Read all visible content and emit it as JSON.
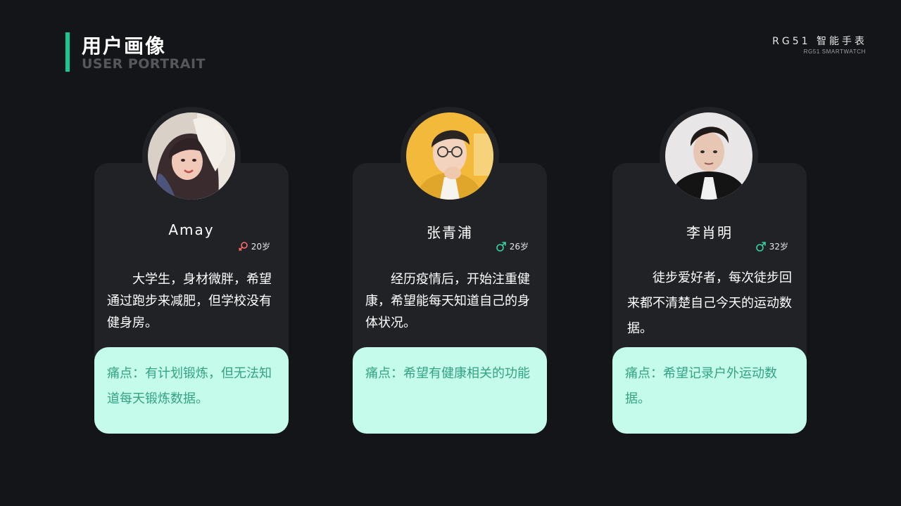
{
  "header": {
    "title_cn": "用户画像",
    "title_en": "USER PORTRAIT",
    "brand_cn": "RG51 智能手表",
    "brand_en": "RG51 SMARTWATCH"
  },
  "colors": {
    "background": "#141518",
    "card": "#202226",
    "accent": "#17c98e",
    "pain_bg": "#c5fbea",
    "pain_text": "#33a383",
    "female": "#ff6b6b",
    "male": "#35d6a6"
  },
  "personas": [
    {
      "name": "Amay",
      "gender_icon": "female-icon",
      "age": "20岁",
      "description": "大学生，身材微胖，希望通过跑步来减肥，但学校没有健身房。",
      "pain_point": "痛点：有计划锻炼，但无法知道每天锻炼数据。"
    },
    {
      "name": "张青浦",
      "gender_icon": "male-icon",
      "age": "26岁",
      "description": "经历疫情后，开始注重健康，希望能每天知道自己的身体状况。",
      "pain_point": "痛点：希望有健康相关的功能"
    },
    {
      "name": "李肖明",
      "gender_icon": "male-icon",
      "age": "32岁",
      "description": "徒步爱好者，每次徒步回来都不清楚自己今天的运动数据。",
      "pain_point": "痛点：希望记录户外运动数据。"
    }
  ]
}
